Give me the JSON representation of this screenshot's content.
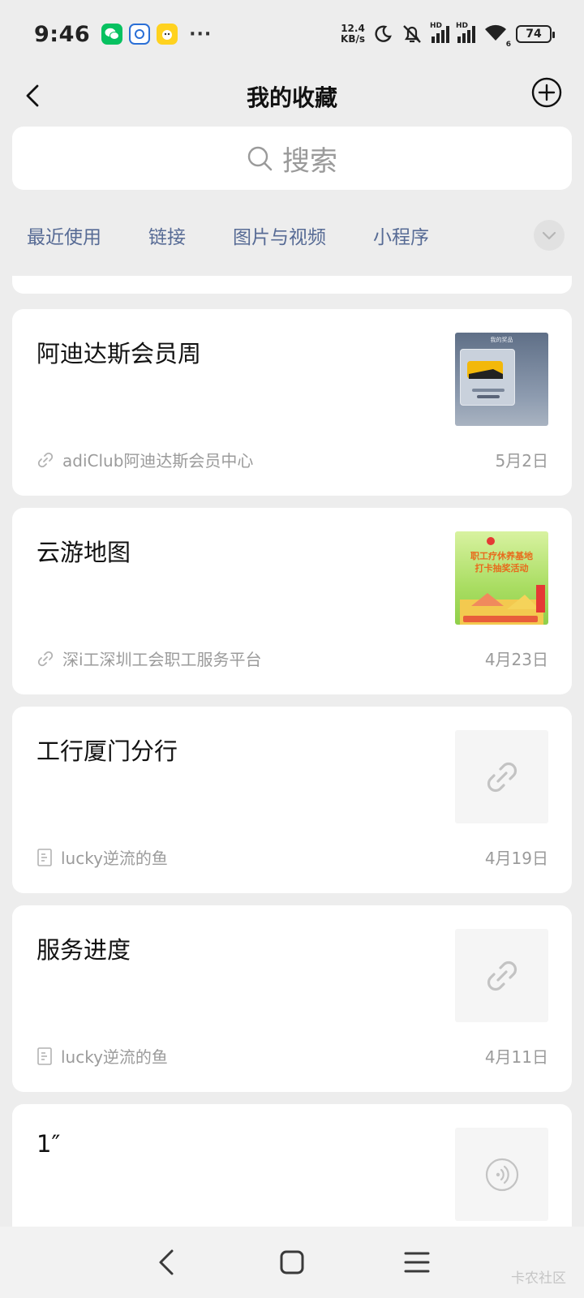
{
  "status": {
    "time": "9:46",
    "net_speed_value": "12.4",
    "net_speed_unit": "KB/s",
    "battery": "74",
    "wifi_badge": "6",
    "hd_label": "HD",
    "more": "···"
  },
  "nav": {
    "title": "我的收藏"
  },
  "search": {
    "placeholder": "搜索"
  },
  "filters": {
    "tabs": [
      "最近使用",
      "链接",
      "图片与视频",
      "小程序"
    ]
  },
  "items": [
    {
      "title": "阿迪达斯会员周",
      "source": "adiClub阿迪达斯会员中心",
      "date": "5月2日",
      "source_icon": "link-icon",
      "thumb": "image"
    },
    {
      "title": "云游地图",
      "source": "深i工深圳工会职工服务平台",
      "date": "4月23日",
      "source_icon": "link-icon",
      "thumb": "image"
    },
    {
      "title": "工行厦门分行",
      "source": "lucky逆流的鱼",
      "date": "4月19日",
      "source_icon": "article-icon",
      "thumb": "link-icon"
    },
    {
      "title": "服务进度",
      "source": "lucky逆流的鱼",
      "date": "4月11日",
      "source_icon": "article-icon",
      "thumb": "link-icon"
    },
    {
      "title": "1″",
      "thumb": "voice-icon"
    }
  ],
  "thumb_texts": {
    "adidas_header": "我的奖品",
    "union_title_1": "职工疗休养基地",
    "union_title_2": "打卡抽奖活动"
  },
  "watermark": "卡农社区",
  "colors": {
    "link_blue": "#576b95",
    "background": "#ededed",
    "card": "#ffffff",
    "meta_gray": "#9b9b9b"
  }
}
